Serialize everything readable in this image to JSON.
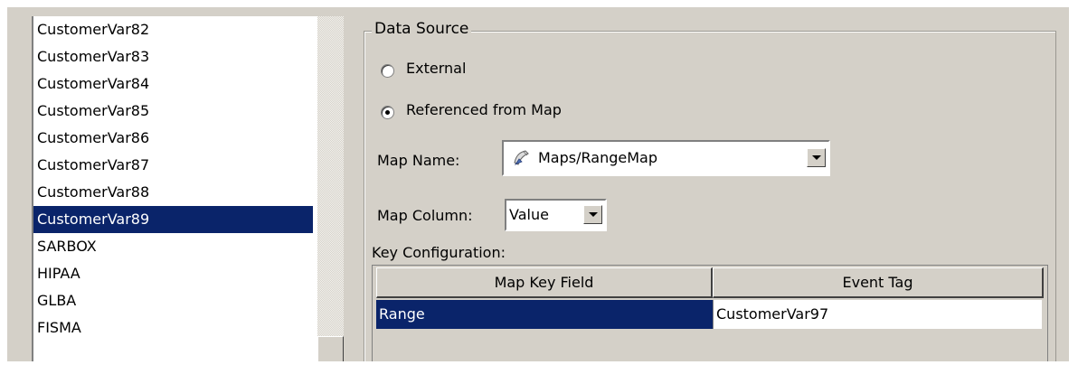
{
  "list": {
    "items": [
      {
        "label": "CustomerVar82",
        "selected": false
      },
      {
        "label": "CustomerVar83",
        "selected": false
      },
      {
        "label": "CustomerVar84",
        "selected": false
      },
      {
        "label": "CustomerVar85",
        "selected": false
      },
      {
        "label": "CustomerVar86",
        "selected": false
      },
      {
        "label": "CustomerVar87",
        "selected": false
      },
      {
        "label": "CustomerVar88",
        "selected": false
      },
      {
        "label": "CustomerVar89",
        "selected": true
      },
      {
        "label": "SARBOX",
        "selected": false
      },
      {
        "label": "HIPAA",
        "selected": false
      },
      {
        "label": "GLBA",
        "selected": false
      },
      {
        "label": "FISMA",
        "selected": false
      }
    ]
  },
  "data_source": {
    "legend": "Data Source",
    "external_label": "External",
    "referenced_label": "Referenced from Map",
    "selected_option": "Referenced from Map"
  },
  "map_name": {
    "label": "Map Name:",
    "value": "Maps/RangeMap",
    "icon": "map-file-icon"
  },
  "map_column": {
    "label": "Map Column:",
    "value": "Value"
  },
  "key_config": {
    "label": "Key Configuration:",
    "columns": [
      "Map Key Field",
      "Event Tag"
    ],
    "rows": [
      {
        "key": "Range",
        "tag": "CustomerVar97"
      }
    ]
  },
  "colors": {
    "selection": "#0a246a",
    "panel": "#d4d0c8"
  }
}
